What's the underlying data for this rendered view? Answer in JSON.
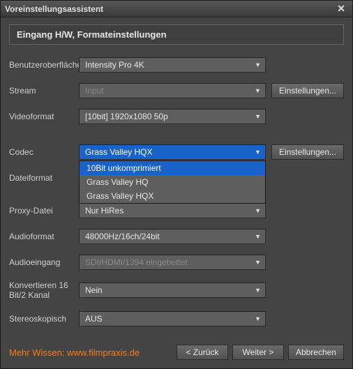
{
  "window": {
    "title": "Voreinstellungsassistent"
  },
  "section": {
    "header": "Eingang H/W, Formateinstellungen"
  },
  "labels": {
    "ui": "Benutzeroberfläche",
    "stream": "Stream",
    "videoformat": "Videoformat",
    "codec": "Codec",
    "dateiformat": "Dateiformat",
    "proxy": "Proxy-Datei",
    "audioformat": "Audioformat",
    "audioeingang": "Audioeingang",
    "konvertieren": "Konvertieren 16 Bit/2 Kanal",
    "stereo": "Stereoskopisch"
  },
  "values": {
    "ui": "Intensity Pro 4K",
    "stream": "Input",
    "videoformat": "[10bit] 1920x1080 50p",
    "codec": "Grass Valley HQX",
    "dateiformat": "",
    "proxy": "Nur HiRes",
    "audioformat": "48000Hz/16ch/24bit",
    "audioeingang": "SDI/HDMI/1394 eingebettet",
    "konvertieren": "Nein",
    "stereo": "AUS"
  },
  "codec_options": [
    "10Bit unkomprimiert",
    "Grass Valley HQ",
    "Grass Valley HQX"
  ],
  "codec_selected_index": 0,
  "buttons": {
    "settings": "Einstellungen...",
    "back": "< Zurück",
    "next": "Weiter >",
    "cancel": "Abbrechen"
  },
  "footer": {
    "prefix": "Mehr Wissen: ",
    "link": "www.filmpraxis.de"
  }
}
